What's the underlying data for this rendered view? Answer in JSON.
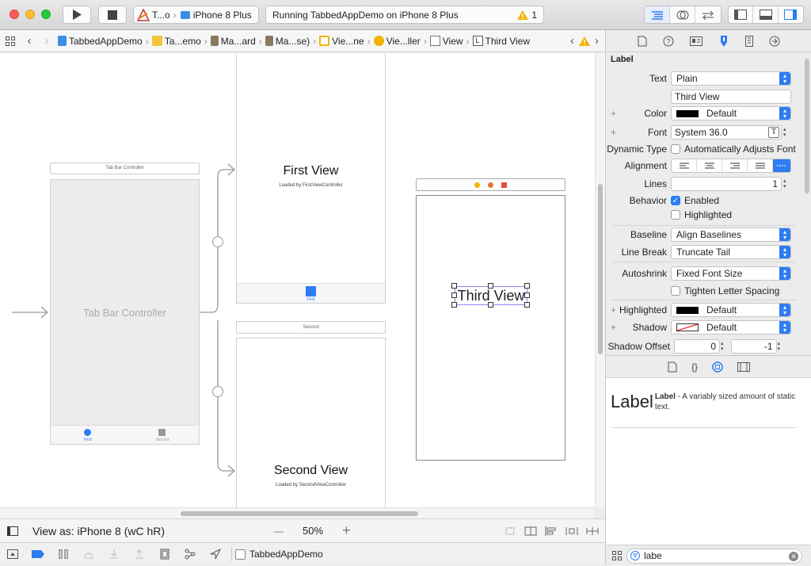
{
  "toolbar": {
    "scheme_target": "T...o",
    "device": "iPhone 8 Plus",
    "activity_text": "Running TabbedAppDemo on iPhone 8 Plus",
    "warning_count": "1"
  },
  "jumpbar": {
    "items": [
      "TabbedAppDemo",
      "Ta...emo",
      "Ma...ard",
      "Ma...se)",
      "Vie...ne",
      "Vie...ller",
      "View",
      "Third View"
    ]
  },
  "canvas": {
    "tab_bar_controller_header": "Tab Bar Controller",
    "tab_bar_controller_title": "Tab Bar Controller",
    "tab_first": "First",
    "tab_second": "Second",
    "first_view_title": "First View",
    "first_view_subtitle": "Loaded by FirstViewController",
    "first_tab_label": "First",
    "second_header": "Second",
    "second_view_title": "Second View",
    "second_view_subtitle": "Loaded by SecondViewController",
    "third_view_label": "Third View"
  },
  "bottombar": {
    "view_as": "View as: iPhone 8 (wC hR)",
    "zoom_minus": "—",
    "zoom": "50%",
    "zoom_plus": "+"
  },
  "debugbar": {
    "app_name": "TabbedAppDemo"
  },
  "inspector": {
    "section": "Label",
    "text_label": "Text",
    "text_type": "Plain",
    "text_value": "Third View",
    "color_label": "Color",
    "color_value": "Default",
    "font_label": "Font",
    "font_value": "System 36.0",
    "dynamic_type_label": "Dynamic Type",
    "dynamic_type_value": "Automatically Adjusts Font",
    "alignment_label": "Alignment",
    "lines_label": "Lines",
    "lines_value": "1",
    "behavior_label": "Behavior",
    "enabled_label": "Enabled",
    "highlighted_check_label": "Highlighted",
    "baseline_label": "Baseline",
    "baseline_value": "Align Baselines",
    "linebreak_label": "Line Break",
    "linebreak_value": "Truncate Tail",
    "autoshrink_label": "Autoshrink",
    "autoshrink_value": "Fixed Font Size",
    "tighten_label": "Tighten Letter Spacing",
    "highlighted_label": "Highlighted",
    "highlighted_value": "Default",
    "shadow_label": "Shadow",
    "shadow_value": "Default",
    "shadow_offset_label": "Shadow Offset",
    "shadow_offset_x": "0",
    "shadow_offset_y": "-1"
  },
  "library": {
    "item_big": "Label",
    "item_name": "Label",
    "item_desc": " - A variably sized amount of static text.",
    "filter": "labe"
  },
  "colors": {
    "accent": "#2d7cf2",
    "selection": "#2d7cf2",
    "warning": "#f5b400"
  }
}
